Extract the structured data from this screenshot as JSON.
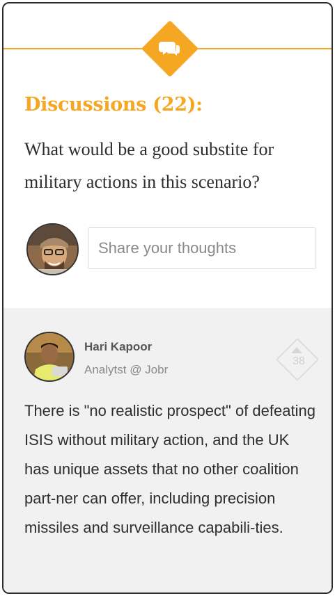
{
  "discussion": {
    "title": "Discussions (22):",
    "question": "What would be a good substite for military actions in this scenario?",
    "share_placeholder": "Share your thoughts"
  },
  "comments": [
    {
      "author": "Hari Kapoor",
      "role": "Analytst @ Jobr",
      "votes": "38",
      "text": "There is \"no realistic prospect\" of defeating ISIS without military action, and the UK has unique assets that no other coalition part-ner can offer, including precision missiles and surveillance capabili-ties."
    }
  ],
  "colors": {
    "accent": "#f5a623",
    "thread_background": "#f1f1f1",
    "text": "#2e2e2e"
  },
  "icons": {
    "header": "chat-bubbles-icon",
    "vote": "upvote-icon"
  }
}
